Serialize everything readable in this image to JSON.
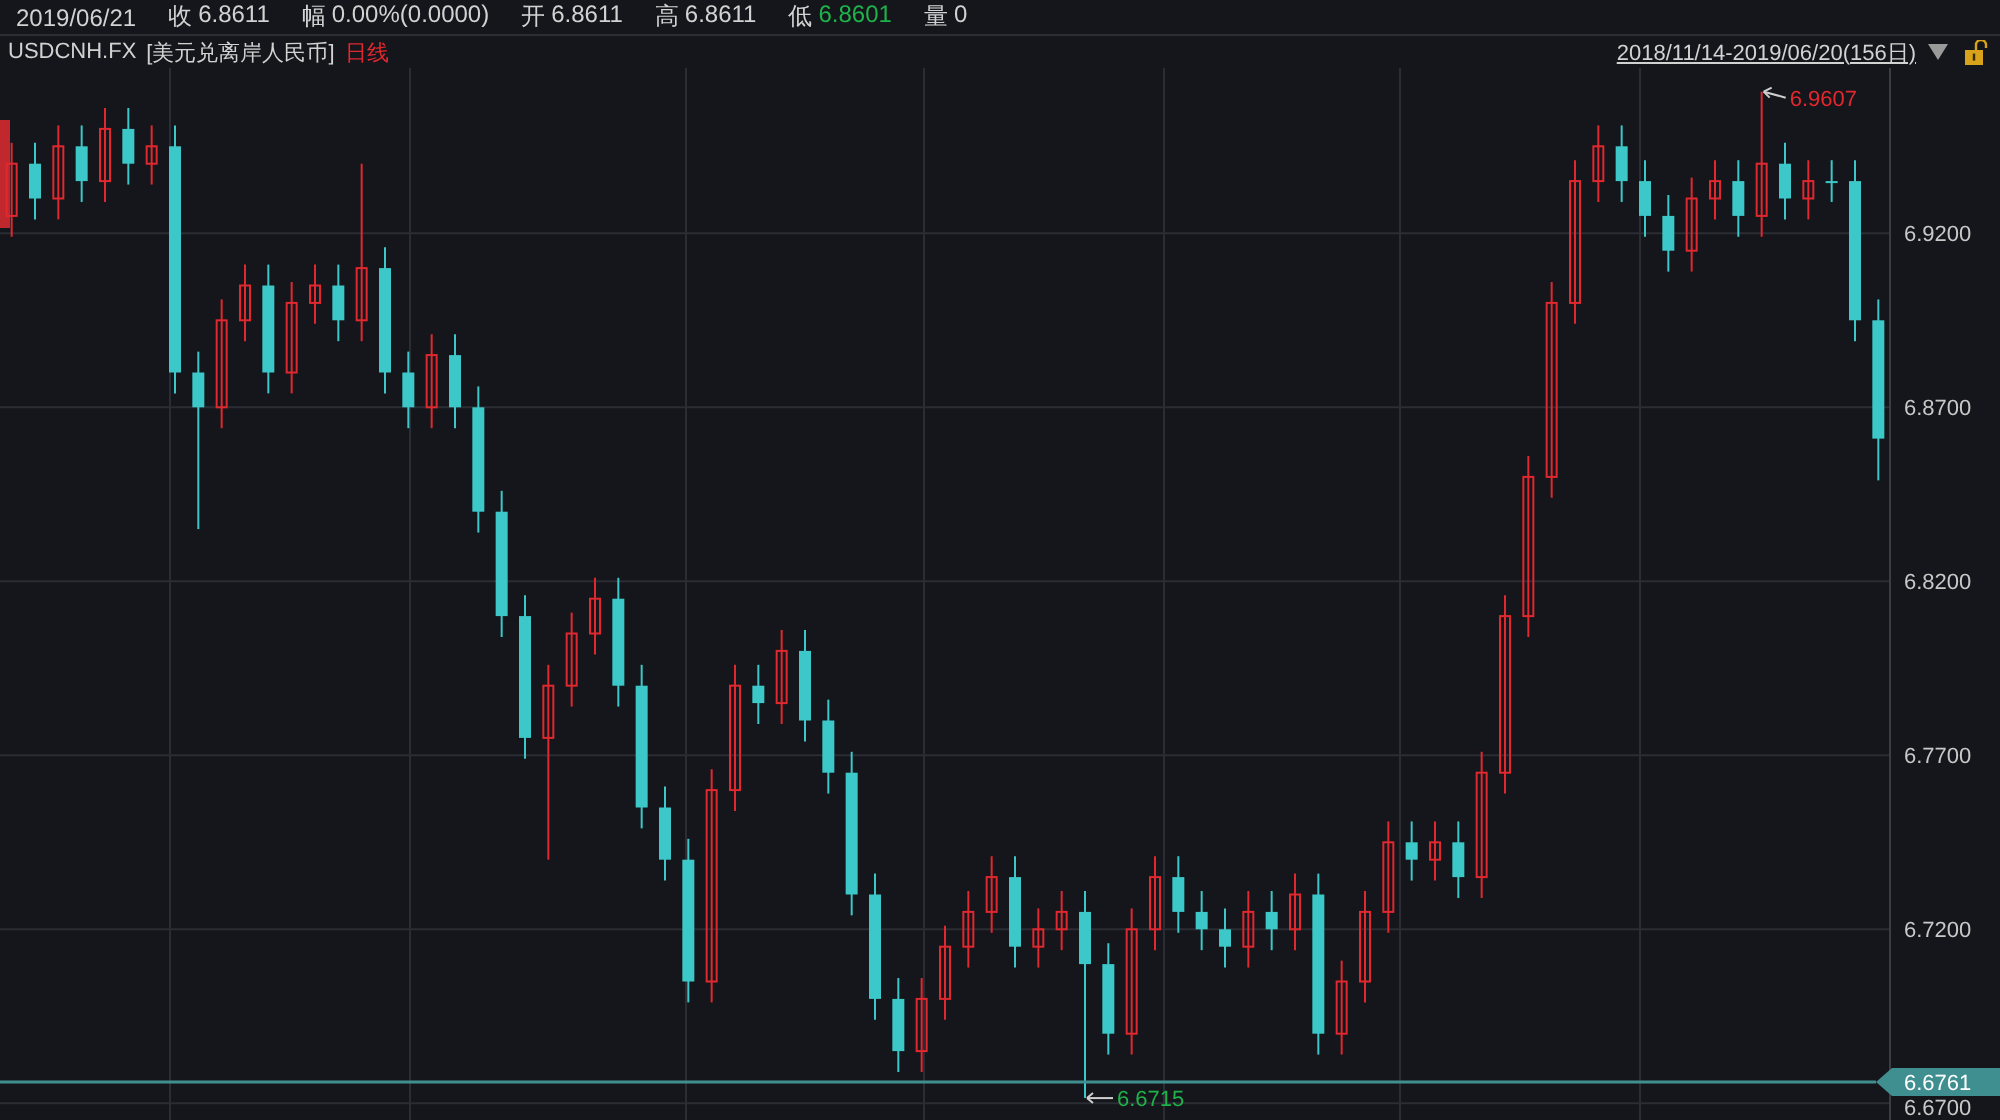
{
  "quote_bar": {
    "date": "2019/06/21",
    "fields": [
      {
        "label": "收",
        "value": "6.8611",
        "color": "#d2d2d2"
      },
      {
        "label": "幅",
        "value": "0.00%(0.0000)",
        "color": "#d2d2d2"
      },
      {
        "label": "开",
        "value": "6.8611",
        "color": "#d2d2d2"
      },
      {
        "label": "高",
        "value": "6.8611",
        "color": "#d2d2d2"
      },
      {
        "label": "低",
        "value": "6.8601",
        "color": "#1fb24a"
      },
      {
        "label": "量",
        "value": "0",
        "color": "#d2d2d2"
      }
    ]
  },
  "chart": {
    "symbol": "USDCNH.FX",
    "name": "[美元兑离岸人民币]",
    "period": "日线",
    "range": "2018/11/14-2019/06/20(156日)",
    "chart_data": {
      "type": "candlestick",
      "ylim": [
        6.6652,
        6.9675
      ],
      "yticks": [
        {
          "value": 6.92,
          "label": "6.9200"
        },
        {
          "value": 6.87,
          "label": "6.8700"
        },
        {
          "value": 6.82,
          "label": "6.8200"
        },
        {
          "value": 6.77,
          "label": "6.7700"
        },
        {
          "value": 6.72,
          "label": "6.7200"
        },
        {
          "value": 6.67,
          "label": "6.6700"
        }
      ],
      "ohlc": [
        [
          6.925,
          6.946,
          6.919,
          6.94
        ],
        [
          6.94,
          6.946,
          6.924,
          6.93
        ],
        [
          6.93,
          6.951,
          6.924,
          6.945
        ],
        [
          6.945,
          6.951,
          6.929,
          6.935
        ],
        [
          6.935,
          6.956,
          6.929,
          6.95
        ],
        [
          6.95,
          6.956,
          6.934,
          6.94
        ],
        [
          6.94,
          6.951,
          6.934,
          6.945
        ],
        [
          6.945,
          6.951,
          6.874,
          6.88
        ],
        [
          6.88,
          6.886,
          6.835,
          6.87
        ],
        [
          6.87,
          6.901,
          6.864,
          6.895
        ],
        [
          6.895,
          6.911,
          6.889,
          6.905
        ],
        [
          6.905,
          6.911,
          6.874,
          6.88
        ],
        [
          6.88,
          6.906,
          6.874,
          6.9
        ],
        [
          6.9,
          6.911,
          6.894,
          6.905
        ],
        [
          6.905,
          6.911,
          6.889,
          6.895
        ],
        [
          6.895,
          6.94,
          6.889,
          6.91
        ],
        [
          6.91,
          6.916,
          6.874,
          6.88
        ],
        [
          6.88,
          6.886,
          6.864,
          6.87
        ],
        [
          6.87,
          6.891,
          6.864,
          6.885
        ],
        [
          6.885,
          6.891,
          6.864,
          6.87
        ],
        [
          6.87,
          6.876,
          6.834,
          6.84
        ],
        [
          6.84,
          6.846,
          6.804,
          6.81
        ],
        [
          6.81,
          6.816,
          6.769,
          6.775
        ],
        [
          6.775,
          6.796,
          6.74,
          6.79
        ],
        [
          6.79,
          6.811,
          6.784,
          6.805
        ],
        [
          6.805,
          6.821,
          6.799,
          6.815
        ],
        [
          6.815,
          6.821,
          6.784,
          6.79
        ],
        [
          6.79,
          6.796,
          6.749,
          6.755
        ],
        [
          6.755,
          6.761,
          6.734,
          6.74
        ],
        [
          6.74,
          6.746,
          6.699,
          6.705
        ],
        [
          6.705,
          6.766,
          6.699,
          6.76
        ],
        [
          6.76,
          6.796,
          6.754,
          6.79
        ],
        [
          6.79,
          6.796,
          6.779,
          6.785
        ],
        [
          6.785,
          6.806,
          6.779,
          6.8
        ],
        [
          6.8,
          6.806,
          6.774,
          6.78
        ],
        [
          6.78,
          6.786,
          6.759,
          6.765
        ],
        [
          6.765,
          6.771,
          6.724,
          6.73
        ],
        [
          6.73,
          6.736,
          6.694,
          6.7
        ],
        [
          6.7,
          6.706,
          6.679,
          6.685
        ],
        [
          6.685,
          6.706,
          6.679,
          6.7
        ],
        [
          6.7,
          6.721,
          6.694,
          6.715
        ],
        [
          6.715,
          6.731,
          6.709,
          6.725
        ],
        [
          6.725,
          6.741,
          6.719,
          6.735
        ],
        [
          6.735,
          6.741,
          6.709,
          6.715
        ],
        [
          6.715,
          6.726,
          6.709,
          6.72
        ],
        [
          6.72,
          6.731,
          6.714,
          6.725
        ],
        [
          6.725,
          6.731,
          6.6715,
          6.71
        ],
        [
          6.71,
          6.716,
          6.684,
          6.69
        ],
        [
          6.69,
          6.726,
          6.684,
          6.72
        ],
        [
          6.72,
          6.741,
          6.714,
          6.735
        ],
        [
          6.735,
          6.741,
          6.719,
          6.725
        ],
        [
          6.725,
          6.731,
          6.714,
          6.72
        ],
        [
          6.72,
          6.726,
          6.709,
          6.715
        ],
        [
          6.715,
          6.731,
          6.709,
          6.725
        ],
        [
          6.725,
          6.731,
          6.714,
          6.72
        ],
        [
          6.72,
          6.736,
          6.714,
          6.73
        ],
        [
          6.73,
          6.736,
          6.684,
          6.69
        ],
        [
          6.69,
          6.711,
          6.684,
          6.705
        ],
        [
          6.705,
          6.731,
          6.699,
          6.725
        ],
        [
          6.725,
          6.751,
          6.719,
          6.745
        ],
        [
          6.745,
          6.751,
          6.734,
          6.74
        ],
        [
          6.74,
          6.751,
          6.734,
          6.745
        ],
        [
          6.745,
          6.751,
          6.729,
          6.735
        ],
        [
          6.735,
          6.771,
          6.729,
          6.765
        ],
        [
          6.765,
          6.816,
          6.759,
          6.81
        ],
        [
          6.81,
          6.856,
          6.804,
          6.85
        ],
        [
          6.85,
          6.906,
          6.844,
          6.9
        ],
        [
          6.9,
          6.941,
          6.894,
          6.935
        ],
        [
          6.935,
          6.951,
          6.929,
          6.945
        ],
        [
          6.945,
          6.951,
          6.929,
          6.935
        ],
        [
          6.935,
          6.941,
          6.919,
          6.925
        ],
        [
          6.925,
          6.931,
          6.909,
          6.915
        ],
        [
          6.915,
          6.936,
          6.909,
          6.93
        ],
        [
          6.93,
          6.941,
          6.924,
          6.935
        ],
        [
          6.935,
          6.941,
          6.919,
          6.925
        ],
        [
          6.925,
          6.9607,
          6.919,
          6.94
        ],
        [
          6.94,
          6.946,
          6.924,
          6.93
        ],
        [
          6.93,
          6.941,
          6.924,
          6.935
        ],
        [
          6.935,
          6.941,
          6.929,
          6.935
        ],
        [
          6.935,
          6.941,
          6.889,
          6.895
        ],
        [
          6.895,
          6.901,
          6.849,
          6.861
        ]
      ],
      "grid": true,
      "annotations": [
        "6.9607",
        "6.6715"
      ],
      "ref_lines": [
        {
          "axis": "y",
          "value": 6.6761,
          "label": "6.6761"
        }
      ]
    }
  }
}
